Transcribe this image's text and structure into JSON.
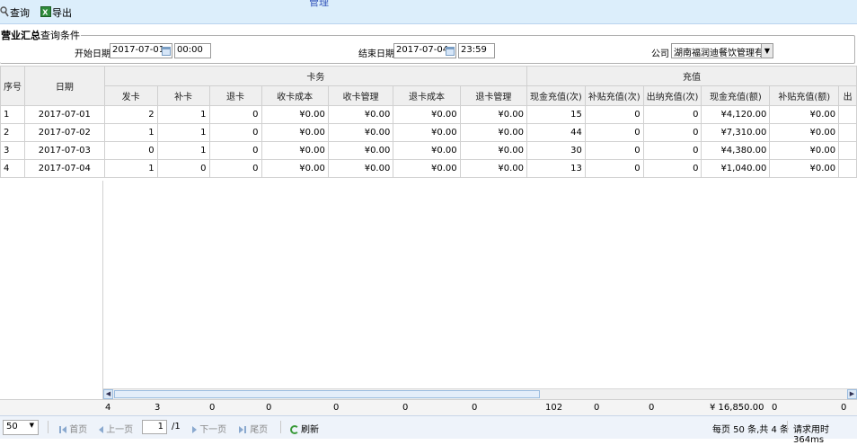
{
  "toolbar": {
    "query_label": "查询",
    "export_label": "导出",
    "title_fragment": "管理"
  },
  "filter": {
    "legend_bold": "营业汇总",
    "legend_rest": "查询条件",
    "start_label": "开始日期",
    "start_date": "2017-07-01",
    "start_time": "00:00",
    "end_label": "结束日期",
    "end_date": "2017-07-04",
    "end_time": "23:59",
    "company_label": "公司",
    "company_value": "湖南福润迪餐饮管理有"
  },
  "table": {
    "group_headers": {
      "seq": "序号",
      "date": "日期",
      "card": "卡务",
      "recharge": "充值"
    },
    "columns": [
      "发卡",
      "补卡",
      "退卡",
      "收卡成本",
      "收卡管理",
      "退卡成本",
      "退卡管理",
      "现金充值(次)",
      "补贴充值(次)",
      "出纳充值(次)",
      "现金充值(额)",
      "补贴充值(额)",
      "出"
    ],
    "rows": [
      [
        "1",
        "2017-07-01",
        "2",
        "1",
        "0",
        "¥0.00",
        "¥0.00",
        "¥0.00",
        "¥0.00",
        "15",
        "0",
        "0",
        "¥4,120.00",
        "¥0.00",
        ""
      ],
      [
        "2",
        "2017-07-02",
        "1",
        "1",
        "0",
        "¥0.00",
        "¥0.00",
        "¥0.00",
        "¥0.00",
        "44",
        "0",
        "0",
        "¥7,310.00",
        "¥0.00",
        ""
      ],
      [
        "3",
        "2017-07-03",
        "0",
        "1",
        "0",
        "¥0.00",
        "¥0.00",
        "¥0.00",
        "¥0.00",
        "30",
        "0",
        "0",
        "¥4,380.00",
        "¥0.00",
        ""
      ],
      [
        "4",
        "2017-07-04",
        "1",
        "0",
        "0",
        "¥0.00",
        "¥0.00",
        "¥0.00",
        "¥0.00",
        "13",
        "0",
        "0",
        "¥1,040.00",
        "¥0.00",
        ""
      ]
    ],
    "totals": [
      "4",
      "3",
      "0",
      "0",
      "0",
      "0",
      "0",
      "102",
      "0",
      "0",
      "¥ 16,850.00",
      "0",
      "0"
    ]
  },
  "pager": {
    "page_size": "50",
    "first": "首页",
    "prev": "上一页",
    "current_page": "1",
    "total_pages": "/1",
    "next": "下一页",
    "last": "尾页",
    "refresh": "刷新",
    "summary": "每页 50 条,共 4 条",
    "elapsed": "请求用时364ms"
  }
}
